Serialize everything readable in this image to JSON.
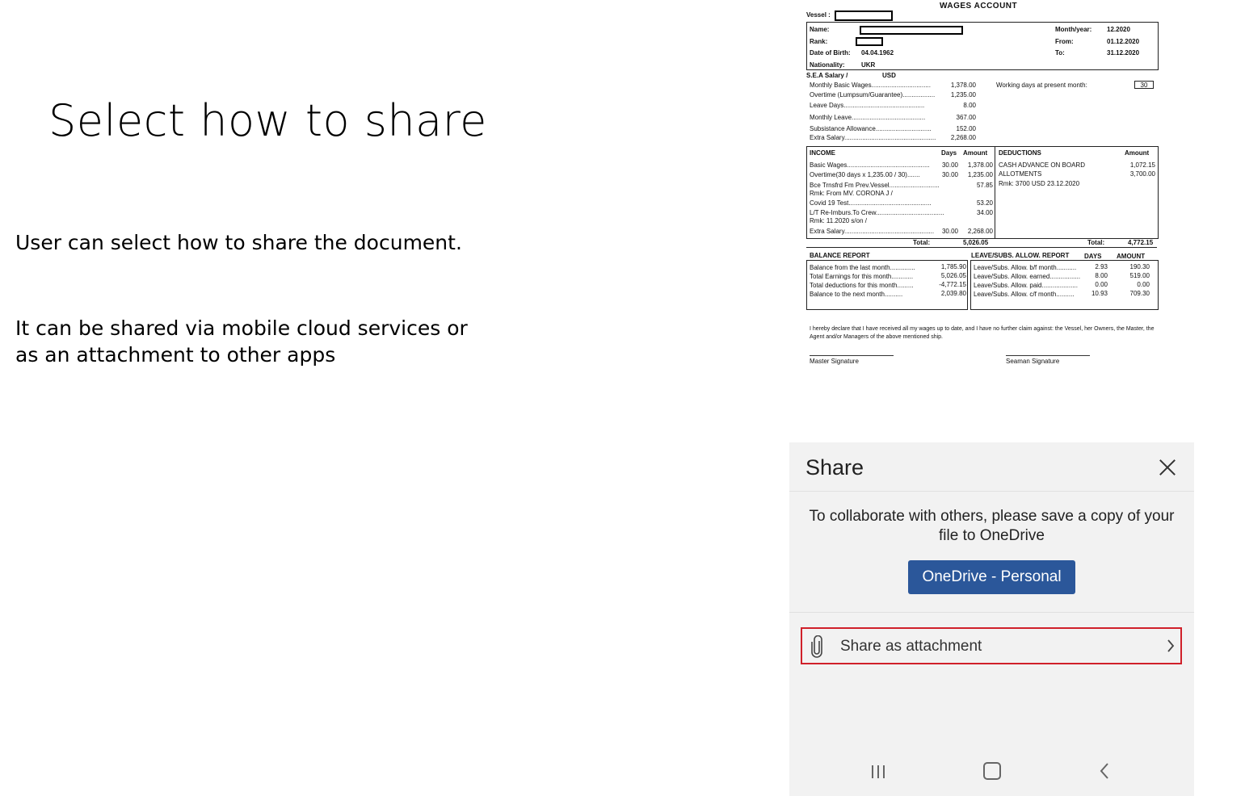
{
  "slide": {
    "title": "Select how to share",
    "para1": "User can select how to share the document.",
    "para2": "It can be shared via mobile cloud services or as an attachment to other apps"
  },
  "document": {
    "header": "WAGES  ACCOUNT",
    "vessel_label": "Vessel :",
    "name_label": "Name:",
    "rank_label": "Rank:",
    "dob_label": "Date of Birth:",
    "dob": "04.04.1962",
    "nationality_label": "Nationality:",
    "nationality": "UKR",
    "month_label": "Month/year:",
    "month": "12.2020",
    "from_label": "From:",
    "from": "01.12.2020",
    "to_label": "To:",
    "to": "31.12.2020",
    "salary_label": "S.E.A Salary /",
    "currency": "USD",
    "working_days_label": "Working days at present month:",
    "working_days": "30",
    "salary_rows": [
      {
        "label": "Monthly Basic Wages.................................",
        "value": "1,378.00"
      },
      {
        "label": "Overtime (Lumpsum/Guarantee)..................",
        "value": "1,235.00"
      },
      {
        "label": "Leave Days.............................................",
        "value": "8.00"
      },
      {
        "label": "Monthly Leave.........................................",
        "value": "367.00"
      },
      {
        "label": "Subsistance Allowance...............................",
        "value": "152.00"
      },
      {
        "label": "Extra Salary...................................................",
        "value": "2,268.00"
      }
    ],
    "income_header": "INCOME",
    "days_header": "Days",
    "amount_header": "Amount",
    "income_rows": [
      {
        "label": "Basic Wages..............................................",
        "days": "30.00",
        "amount": "1,378.00"
      },
      {
        "label": "Overtime(30 days x   1,235.00 / 30).......",
        "days": "30.00",
        "amount": "1,235.00"
      },
      {
        "label": "Bce Trnsfrd Fm Prev.Vessel............................",
        "days": "",
        "amount": "57.85"
      },
      {
        "label": "   Rmk: From MV. CORONA J /",
        "days": "",
        "amount": ""
      },
      {
        "label": "Covid 19 Test..............................................",
        "days": "",
        "amount": "53.20"
      },
      {
        "label": "L/T Re-Imburs.To Crew......................................",
        "days": "",
        "amount": "34.00"
      },
      {
        "label": "   Rmk: 11.2020 s/on /",
        "days": "",
        "amount": ""
      },
      {
        "label": "Extra Salary..................................................",
        "days": "30.00",
        "amount": "2,268.00"
      }
    ],
    "deductions_header": "DEDUCTIONS",
    "deductions_amount_header": "Amount",
    "deduction_rows": [
      {
        "label": "CASH ADVANCE ON BOARD",
        "amount": "1,072.15"
      },
      {
        "label": "ALLOTMENTS",
        "amount": "3,700.00"
      },
      {
        "label": "Rmk: 3700 USD 23.12.2020",
        "amount": ""
      }
    ],
    "total_label": "Total:",
    "income_total": "5,026.05",
    "deduction_total": "4,772.15",
    "balance_header": "BALANCE REPORT",
    "balance_rows": [
      {
        "label": "Balance from the last month..............",
        "value": "1,785.90"
      },
      {
        "label": "Total Earnings for this month............",
        "value": "5,026.05"
      },
      {
        "label": "Total deductions for this month.........",
        "value": "-4,772.15"
      },
      {
        "label": "Balance to the next month..........",
        "value": "2,039.80"
      }
    ],
    "leave_header": "LEAVE/SUBS. ALLOW. REPORT",
    "leave_days_header": "DAYS",
    "leave_amount_header": "AMOUNT",
    "leave_rows": [
      {
        "label": "Leave/Subs. Allow.  b/f month...........",
        "days": "2.93",
        "amount": "190.30"
      },
      {
        "label": "Leave/Subs. Allow. earned.................",
        "days": "8.00",
        "amount": "519.00"
      },
      {
        "label": "Leave/Subs. Allow. paid....................",
        "days": "0.00",
        "amount": "0.00"
      },
      {
        "label": "Leave/Subs. Allow. c/f month..........",
        "days": "10.93",
        "amount": "709.30"
      }
    ],
    "declaration": "I hereby declare that I have received all my wages up to date, and I have no further claim against: the Vessel, her Owners, the Master, the Agent and/or Managers of the above mentioned ship.",
    "master_signature": "Master Signature",
    "seaman_signature": "Seaman Signature"
  },
  "share": {
    "title": "Share",
    "collab_text": "To collaborate with others, please save a copy of your file to OneDrive",
    "onedrive_button": "OneDrive - Personal",
    "attachment_label": "Share as attachment",
    "accent": "#2b579a",
    "highlight": "#d0202a"
  }
}
